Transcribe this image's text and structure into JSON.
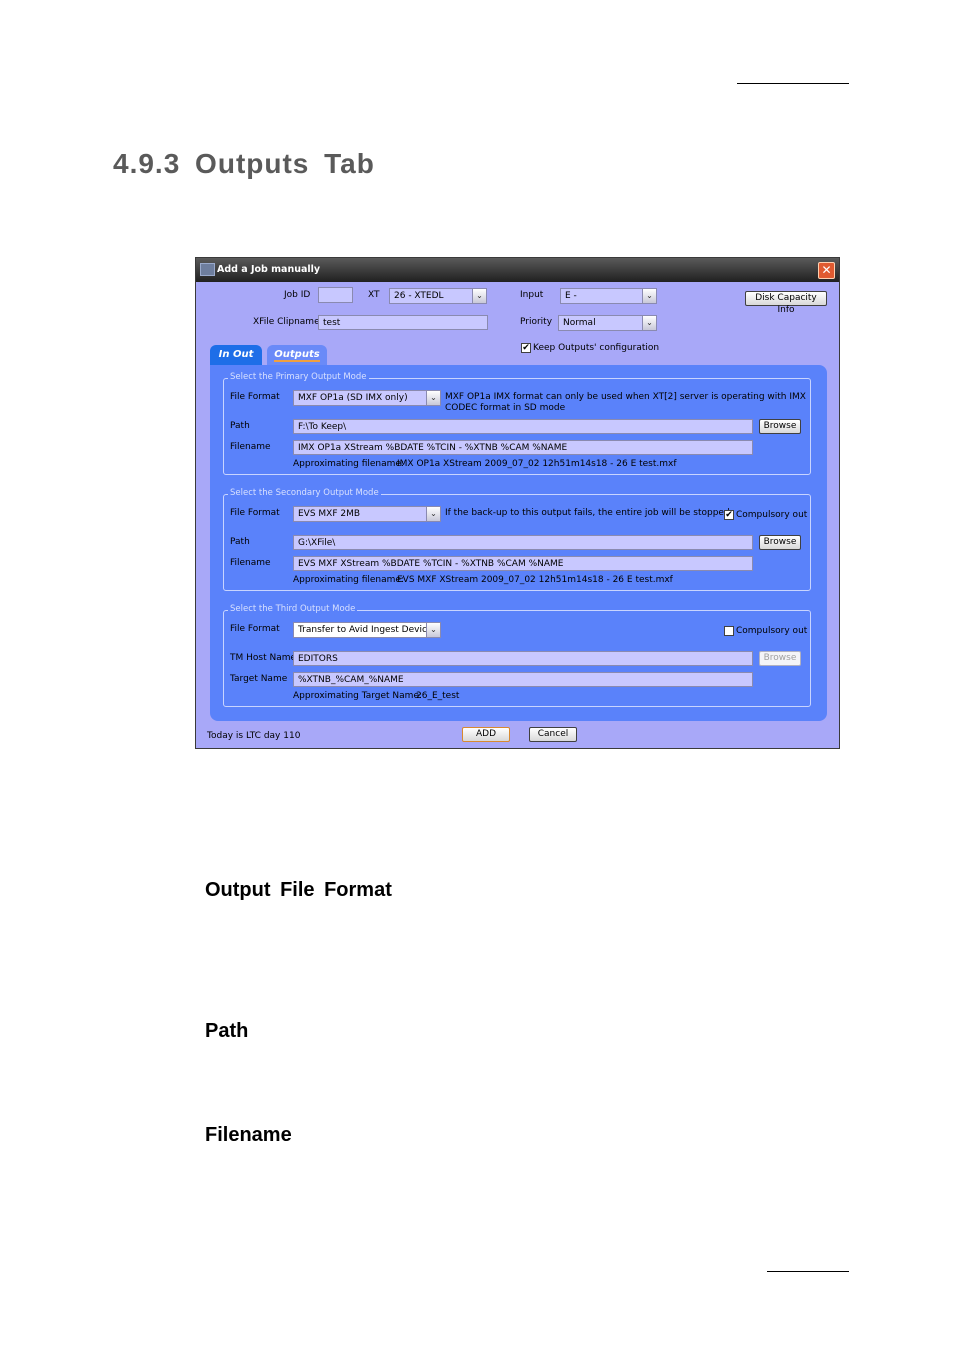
{
  "page": {
    "section_title": "4.9.3  Outputs  Tab",
    "subheadings": [
      "Output  File  Format",
      "Path",
      "Filename"
    ]
  },
  "dialog": {
    "title": "Add a Job manually",
    "job_id_label": "Job ID",
    "job_id_value": "",
    "xt_label": "XT",
    "xt_value": "26 - XTEDL",
    "input_label": "Input",
    "input_value": "E -",
    "disk_capacity_button": "Disk Capacity Info",
    "xfile_clipname_label": "XFile Clipname",
    "xfile_clipname_value": "test",
    "priority_label": "Priority",
    "priority_value": "Normal",
    "keep_outputs_label": "Keep Outputs' configuration",
    "keep_outputs_checked": true,
    "tabs": [
      {
        "label": "In Out",
        "active": false
      },
      {
        "label": "Outputs",
        "active": true
      }
    ],
    "primary": {
      "legend": "Select the Primary Output Mode",
      "file_format_label": "File Format",
      "file_format_value": "MXF OP1a (SD IMX only)",
      "hint_line1": "MXF OP1a IMX format can only be used when XT[2] server is operating with IMX",
      "hint_line2": "CODEC format in SD mode",
      "path_label": "Path",
      "path_value": "F:\\To Keep\\",
      "browse_label": "Browse",
      "filename_label": "Filename",
      "filename_value": "IMX OP1a XStream %BDATE %TCIN - %XTNB %CAM %NAME",
      "approx_label": "Approximating filename:",
      "approx_value": "IMX OP1a XStream 2009_07_02 12h51m14s18 - 26 E test.mxf"
    },
    "secondary": {
      "legend": "Select the Secondary Output Mode",
      "file_format_label": "File Format",
      "file_format_value": "EVS MXF 2MB",
      "hint": "If the back-up to this output fails, the entire job will be stopped.",
      "compulsory_label": "Compulsory out",
      "compulsory_checked": true,
      "path_label": "Path",
      "path_value": "G:\\XFile\\",
      "browse_label": "Browse",
      "filename_label": "Filename",
      "filename_value": "EVS MXF XStream %BDATE %TCIN - %XTNB %CAM %NAME",
      "approx_label": "Approximating filename:",
      "approx_value": "EVS MXF XStream 2009_07_02 12h51m14s18 - 26 E test.mxf"
    },
    "third": {
      "legend": "Select the Third Output Mode",
      "file_format_label": "File Format",
      "file_format_value": "Transfer to Avid Ingest Device",
      "compulsory_label": "Compulsory out",
      "compulsory_checked": false,
      "host_label": "TM Host Name",
      "host_value": "EDITORS",
      "browse_label": "Browse",
      "target_label": "Target Name",
      "target_value": "%XTNB_%CAM_%NAME",
      "approx_label": "Approximating Target Name:",
      "approx_value": "26_E_test"
    },
    "status_text": "Today is LTC day 110",
    "add_button": "ADD",
    "cancel_button": "Cancel",
    "check_glyph": "✔",
    "arrow_glyph": "⌄",
    "close_glyph": "✕"
  }
}
